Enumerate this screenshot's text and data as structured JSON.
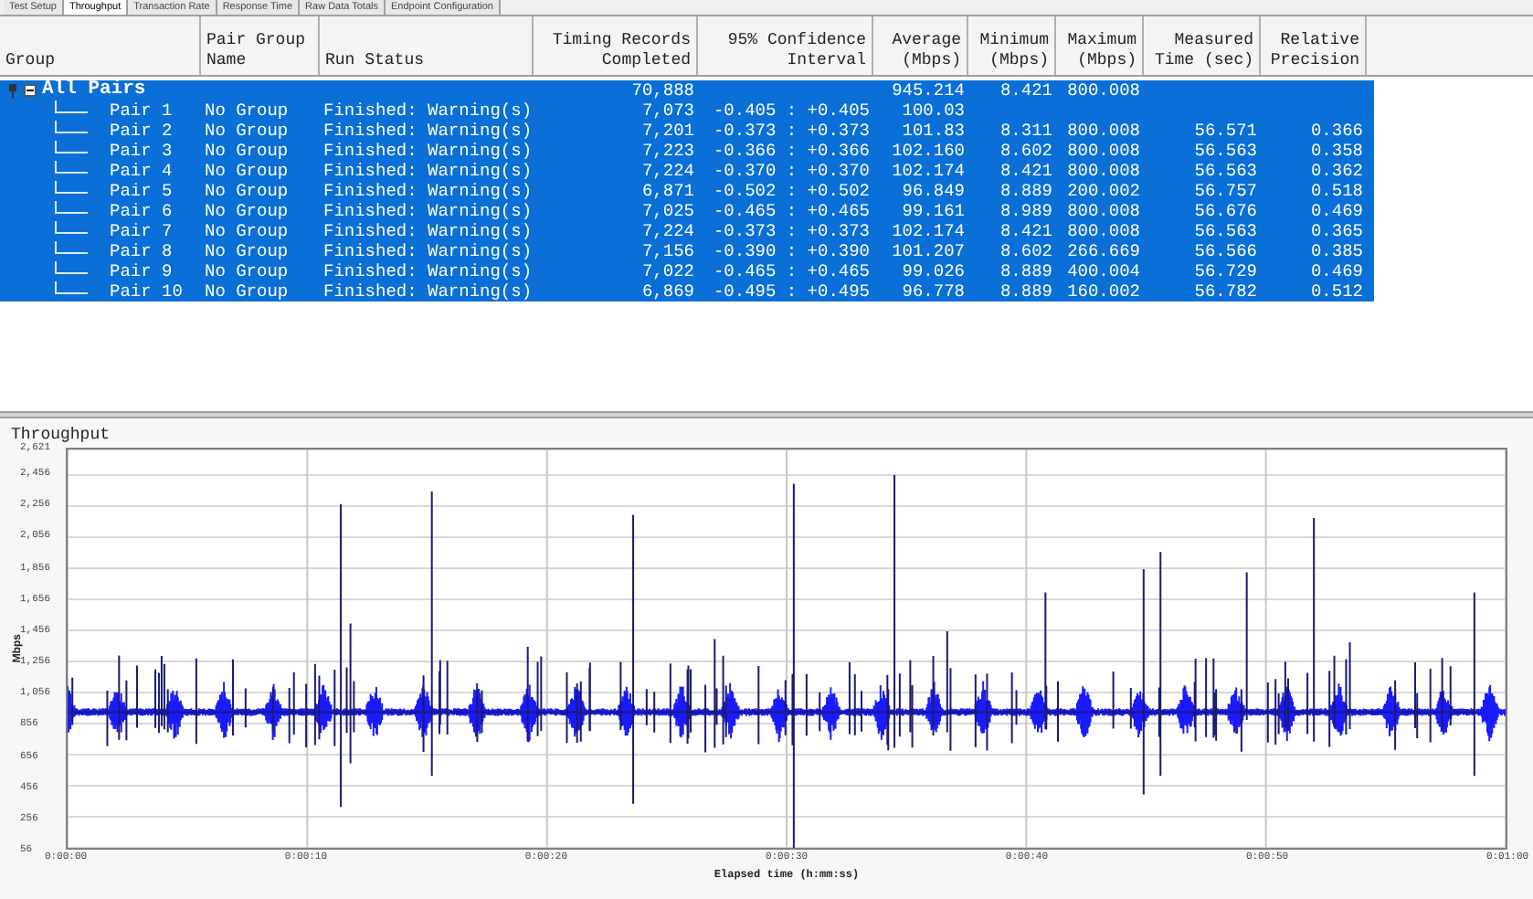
{
  "tabs": [
    {
      "label": "Test Setup",
      "selected": false
    },
    {
      "label": "Throughput",
      "selected": true
    },
    {
      "label": "Transaction Rate",
      "selected": false
    },
    {
      "label": "Response Time",
      "selected": false
    },
    {
      "label": "Raw Data Totals",
      "selected": false
    },
    {
      "label": "Endpoint Configuration",
      "selected": false
    }
  ],
  "table": {
    "columns": [
      "Group",
      "Pair Group Name",
      "Run Status",
      "Timing Records Completed",
      "95% Confidence Interval",
      "Average (Mbps)",
      "Minimum (Mbps)",
      "Maximum (Mbps)",
      "Measured Time (sec)",
      "Relative Precision"
    ],
    "summary": {
      "name": "All Pairs",
      "expanded": true,
      "selected": true,
      "records": "70,888",
      "average": "945.214",
      "minimum": "8.421",
      "maximum": "800.008"
    },
    "rows": [
      {
        "name": "Pair 1",
        "group": "No Group",
        "status": "Finished: Warning(s)",
        "records": "7,073",
        "interval": "-0.405 : +0.405",
        "average": "100.03",
        "selected": true
      },
      {
        "name": "Pair 2",
        "group": "No Group",
        "status": "Finished: Warning(s)",
        "records": "7,201",
        "interval": "-0.373 : +0.373",
        "average": "101.83",
        "minimum": "8.311",
        "maximum": "800.008",
        "time": "56.571",
        "precision": "0.366",
        "selected": true
      },
      {
        "name": "Pair 3",
        "group": "No Group",
        "status": "Finished: Warning(s)",
        "records": "7,223",
        "interval": "-0.366 : +0.366",
        "average": "102.160",
        "minimum": "8.602",
        "maximum": "800.008",
        "time": "56.563",
        "precision": "0.358",
        "selected": true
      },
      {
        "name": "Pair 4",
        "group": "No Group",
        "status": "Finished: Warning(s)",
        "records": "7,224",
        "interval": "-0.370 : +0.370",
        "average": "102.174",
        "minimum": "8.421",
        "maximum": "800.008",
        "time": "56.563",
        "precision": "0.362",
        "selected": true
      },
      {
        "name": "Pair 5",
        "group": "No Group",
        "status": "Finished: Warning(s)",
        "records": "6,871",
        "interval": "-0.502 : +0.502",
        "average": "96.849",
        "minimum": "8.889",
        "maximum": "200.002",
        "time": "56.757",
        "precision": "0.518",
        "selected": true
      },
      {
        "name": "Pair 6",
        "group": "No Group",
        "status": "Finished: Warning(s)",
        "records": "7,025",
        "interval": "-0.465 : +0.465",
        "average": "99.161",
        "minimum": "8.989",
        "maximum": "800.008",
        "time": "56.676",
        "precision": "0.469",
        "selected": true
      },
      {
        "name": "Pair 7",
        "group": "No Group",
        "status": "Finished: Warning(s)",
        "records": "7,224",
        "interval": "-0.373 : +0.373",
        "average": "102.174",
        "minimum": "8.421",
        "maximum": "800.008",
        "time": "56.563",
        "precision": "0.365",
        "selected": true
      },
      {
        "name": "Pair 8",
        "group": "No Group",
        "status": "Finished: Warning(s)",
        "records": "7,156",
        "interval": "-0.390 : +0.390",
        "average": "101.207",
        "minimum": "8.602",
        "maximum": "266.669",
        "time": "56.566",
        "precision": "0.385",
        "selected": true
      },
      {
        "name": "Pair 9",
        "group": "No Group",
        "status": "Finished: Warning(s)",
        "records": "7,022",
        "interval": "-0.465 : +0.465",
        "average": "99.026",
        "minimum": "8.889",
        "maximum": "400.004",
        "time": "56.729",
        "precision": "0.469",
        "selected": true
      },
      {
        "name": "Pair 10",
        "group": "No Group",
        "status": "Finished: Warning(s)",
        "records": "6,869",
        "interval": "-0.495 : +0.495",
        "average": "96.778",
        "minimum": "8.889",
        "maximum": "160.002",
        "time": "56.782",
        "precision": "0.512",
        "selected": true
      }
    ]
  },
  "chart": {
    "title": "Throughput",
    "ylabel": "Mbps",
    "xlabel": "Elapsed time (h:mm:ss)",
    "yticks": [
      "2,621",
      "2,456",
      "2,256",
      "2,056",
      "1,856",
      "1,656",
      "1,456",
      "1,256",
      "1,056",
      "856",
      "656",
      "456",
      "256",
      "56"
    ],
    "xticks": [
      "0:00:00",
      "0:00:10",
      "0:00:20",
      "0:00:30",
      "0:00:40",
      "0:00:50",
      "0:01:00"
    ]
  }
}
